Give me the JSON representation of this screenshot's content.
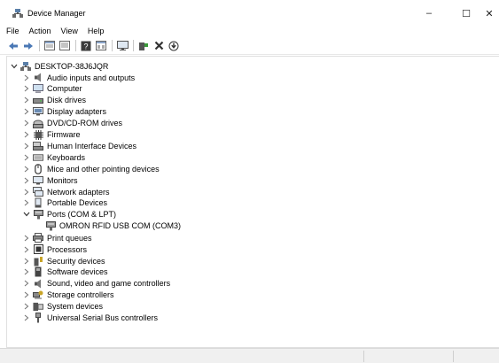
{
  "window": {
    "title": "Device Manager",
    "min_glyph": "–",
    "max_glyph": "☐",
    "close_glyph": "✕"
  },
  "menu": [
    "File",
    "Action",
    "View",
    "Help"
  ],
  "toolbar": {
    "icons": [
      "back-arrow-icon",
      "forward-arrow-icon",
      "properties-icon",
      "update-driver-icon",
      "help-icon",
      "show-hidden-icon",
      "monitor-icon",
      "add-driver-icon",
      "uninstall-icon",
      "scan-hardware-icon"
    ]
  },
  "tree": {
    "root": "DESKTOP-38J6JQR",
    "categories": [
      {
        "label": "Audio inputs and outputs",
        "icon": "speaker-icon",
        "expanded": false
      },
      {
        "label": "Computer",
        "icon": "computer-icon",
        "expanded": false
      },
      {
        "label": "Disk drives",
        "icon": "disk-drive-icon",
        "expanded": false
      },
      {
        "label": "Display adapters",
        "icon": "display-adapter-icon",
        "expanded": false
      },
      {
        "label": "DVD/CD-ROM drives",
        "icon": "dvd-drive-icon",
        "expanded": false
      },
      {
        "label": "Firmware",
        "icon": "firmware-chip-icon",
        "expanded": false
      },
      {
        "label": "Human Interface Devices",
        "icon": "hid-icon",
        "expanded": false
      },
      {
        "label": "Keyboards",
        "icon": "keyboard-icon",
        "expanded": false
      },
      {
        "label": "Mice and other pointing devices",
        "icon": "mouse-icon",
        "expanded": false
      },
      {
        "label": "Monitors",
        "icon": "monitor-icon",
        "expanded": false
      },
      {
        "label": "Network adapters",
        "icon": "network-adapter-icon",
        "expanded": false
      },
      {
        "label": "Portable Devices",
        "icon": "portable-device-icon",
        "expanded": false
      },
      {
        "label": "Ports (COM & LPT)",
        "icon": "port-icon",
        "expanded": true,
        "children": [
          "OMRON RFID USB COM (COM3)"
        ]
      },
      {
        "label": "Print queues",
        "icon": "printer-icon",
        "expanded": false
      },
      {
        "label": "Processors",
        "icon": "processor-icon",
        "expanded": false
      },
      {
        "label": "Security devices",
        "icon": "security-device-icon",
        "expanded": false
      },
      {
        "label": "Software devices",
        "icon": "software-device-icon",
        "expanded": false
      },
      {
        "label": "Sound, video and game controllers",
        "icon": "sound-controller-icon",
        "expanded": false
      },
      {
        "label": "Storage controllers",
        "icon": "storage-controller-icon",
        "expanded": false
      },
      {
        "label": "System devices",
        "icon": "system-devices-icon",
        "expanded": false
      },
      {
        "label": "Universal Serial Bus controllers",
        "icon": "usb-icon",
        "expanded": false
      }
    ]
  }
}
